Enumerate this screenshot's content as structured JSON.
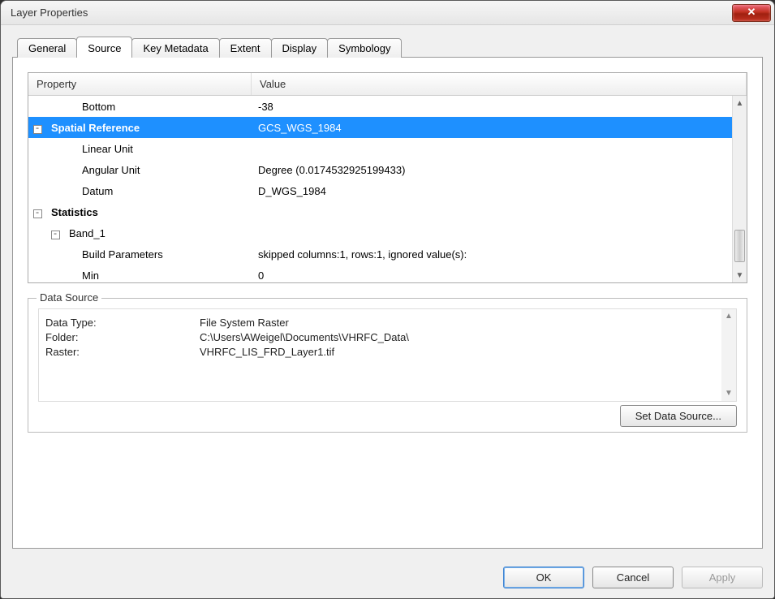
{
  "window": {
    "title": "Layer Properties"
  },
  "tabs": [
    "General",
    "Source",
    "Key Metadata",
    "Extent",
    "Display",
    "Symbology"
  ],
  "activeTab": 1,
  "grid": {
    "headers": {
      "property": "Property",
      "value": "Value"
    },
    "rows": [
      {
        "indent": 2,
        "label": "Bottom",
        "value": "-38"
      },
      {
        "indent": 0,
        "exp": "-",
        "bold": true,
        "selected": true,
        "label": "Spatial Reference",
        "value": "GCS_WGS_1984"
      },
      {
        "indent": 2,
        "label": "Linear Unit",
        "value": ""
      },
      {
        "indent": 2,
        "label": "Angular Unit",
        "value": "Degree (0.0174532925199433)"
      },
      {
        "indent": 2,
        "label": "Datum",
        "value": "D_WGS_1984"
      },
      {
        "indent": 0,
        "exp": "-",
        "bold": true,
        "label": "Statistics",
        "value": ""
      },
      {
        "indent": 1,
        "exp": "-",
        "label": "Band_1",
        "value": ""
      },
      {
        "indent": 2,
        "label": "Build Parameters",
        "value": "skipped columns:1, rows:1, ignored value(s):"
      },
      {
        "indent": 2,
        "label": "Min",
        "value": "0"
      }
    ]
  },
  "dataSource": {
    "legend": "Data Source",
    "dataType": {
      "k": "Data Type:",
      "v": "File System Raster"
    },
    "folder": {
      "k": "Folder:",
      "v": "C:\\Users\\AWeigel\\Documents\\VHRFC_Data\\"
    },
    "raster": {
      "k": "Raster:",
      "v": "VHRFC_LIS_FRD_Layer1.tif"
    },
    "setBtn": "Set Data Source..."
  },
  "footer": {
    "ok": "OK",
    "cancel": "Cancel",
    "apply": "Apply"
  }
}
